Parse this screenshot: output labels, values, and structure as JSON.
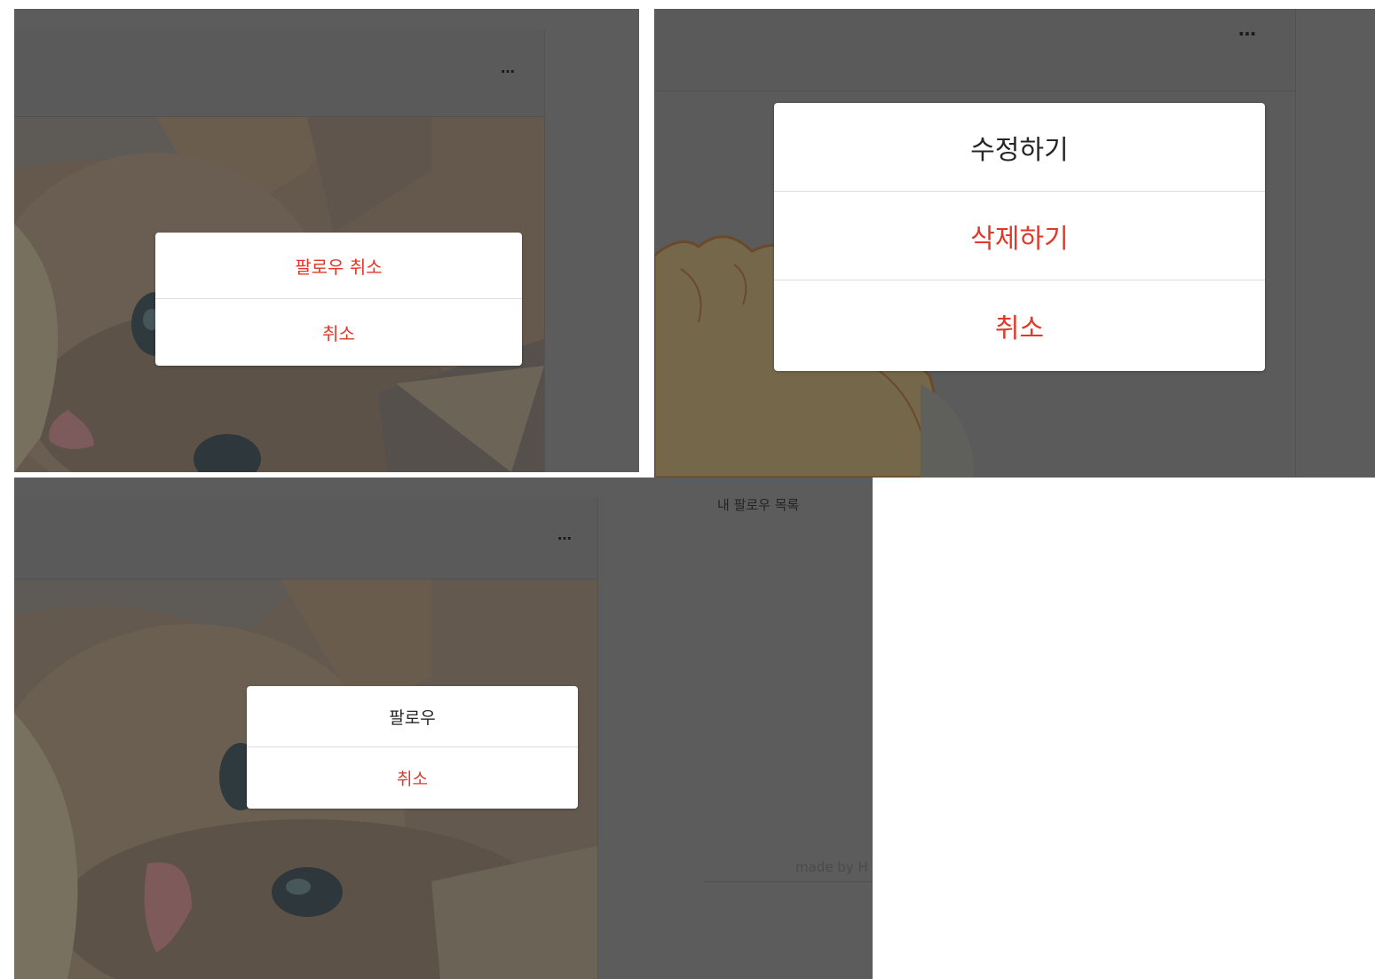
{
  "panels": {
    "top_left": {
      "more_icon": "…",
      "sheet": [
        {
          "label": "팔로우 취소",
          "style": "danger"
        },
        {
          "label": "취소",
          "style": "danger"
        }
      ]
    },
    "top_right": {
      "more_icon": "…",
      "sheet": [
        {
          "label": "수정하기",
          "style": "normal"
        },
        {
          "label": "삭제하기",
          "style": "danger"
        },
        {
          "label": "취소",
          "style": "danger"
        }
      ]
    },
    "bottom_left": {
      "more_icon": "…",
      "sidebar_title": "내 팔로우 목록",
      "footer_text": "made by H",
      "sheet": [
        {
          "label": "팔로우",
          "style": "normal"
        },
        {
          "label": "취소",
          "style": "danger"
        }
      ]
    }
  },
  "colors": {
    "overlay": "#5a5a5a",
    "sheet_bg": "#ffffff",
    "danger": "#e2382a",
    "normal": "#262626"
  },
  "icons": {
    "more": "more-horizontal-icon",
    "kitten": "kitten-photo",
    "cartoon": "cartoon-hand-illustration"
  }
}
